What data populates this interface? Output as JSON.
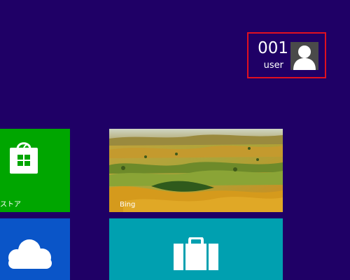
{
  "account": {
    "user_name": "001",
    "user_sub": "user"
  },
  "tiles": {
    "store": {
      "label": "ストア",
      "color": "#00a600"
    },
    "bing": {
      "label": "Bing"
    },
    "skydrive": {
      "color": "#0a55c8"
    },
    "travel": {
      "color": "#00a0b0"
    }
  },
  "icons": {
    "store": "store-bag-icon",
    "avatar": "user-silhouette-icon",
    "skydrive": "cloud-icon",
    "travel": "suitcase-icon"
  },
  "colors": {
    "background": "#1f0066",
    "highlight": "#e01020"
  }
}
